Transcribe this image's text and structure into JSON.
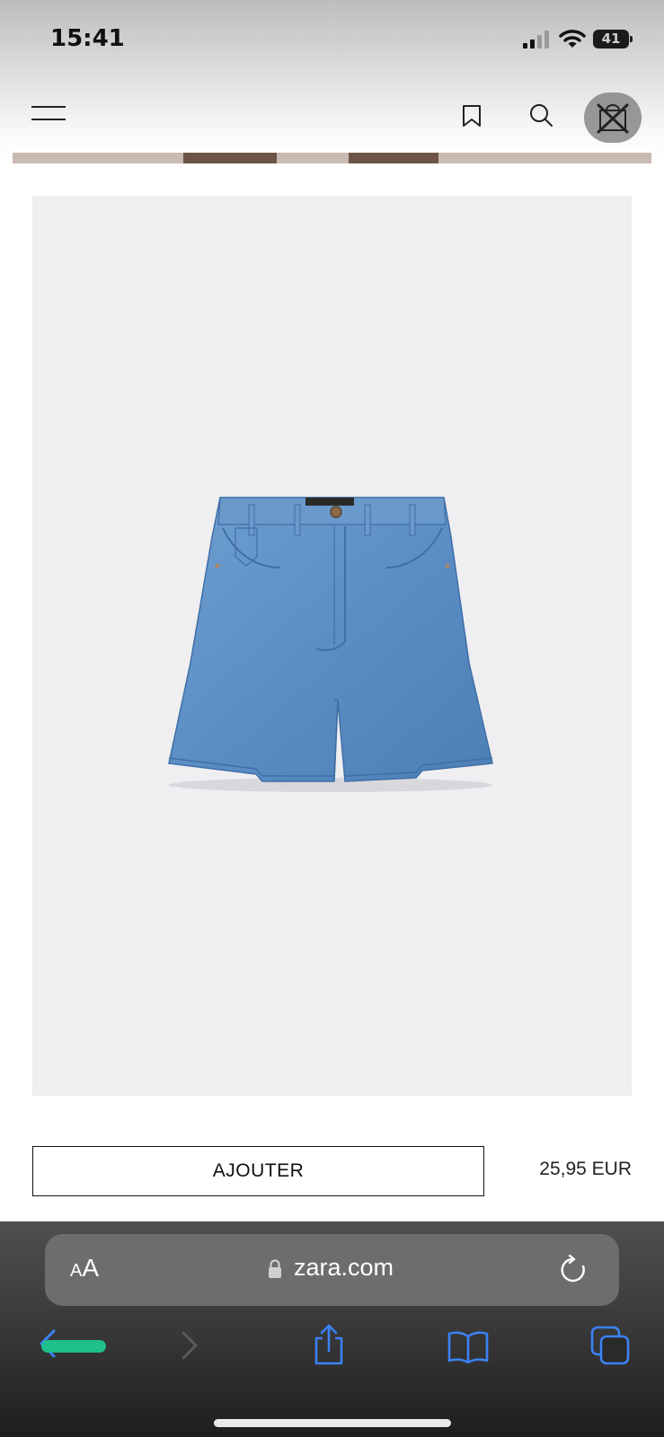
{
  "status_bar": {
    "time": "15:41",
    "battery": "41"
  },
  "header": {
    "menu_icon": "hamburger-icon",
    "bookmark_icon": "bookmark-icon",
    "search_icon": "search-icon",
    "bag_icon": "shopping-bag-icon"
  },
  "product": {
    "image_description_icon": "denim-shorts-image",
    "add_label": "AJOUTER",
    "price": "25,95 EUR"
  },
  "browser": {
    "text_size_small": "A",
    "text_size_big": "A",
    "url": "zara.com",
    "lock_icon": "lock-icon",
    "reload_icon": "reload-icon",
    "back_icon": "back-arrow-icon",
    "forward_icon": "forward-arrow-icon",
    "share_icon": "share-icon",
    "bookmarks_icon": "open-book-icon",
    "tabs_icon": "tabs-icon",
    "accent_color": "#1fbf8b"
  }
}
